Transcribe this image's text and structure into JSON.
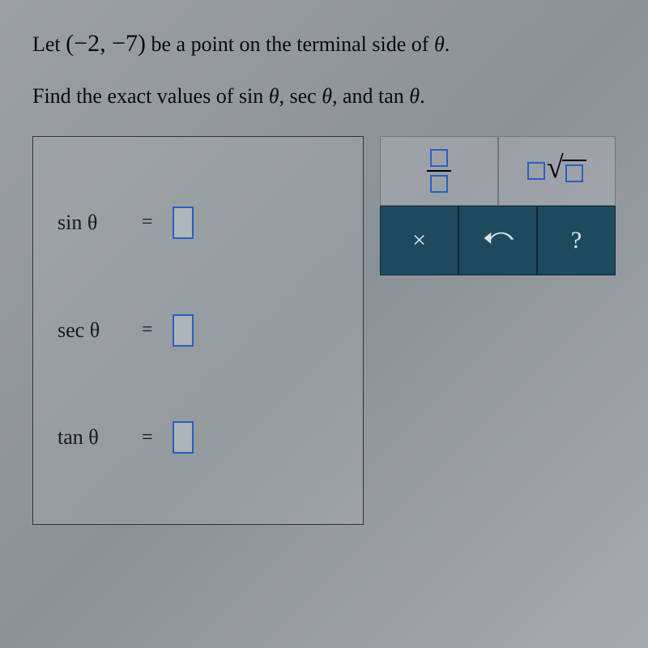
{
  "problem": {
    "line1_pre": "Let ",
    "point": "(−2, −7)",
    "line1_post": " be a point on the terminal side of ",
    "theta1": "θ",
    "period1": ".",
    "line2_pre": "Find the exact values of ",
    "func_sin": "sin",
    "theta2": "θ",
    "comma1": ", ",
    "func_sec": "sec",
    "theta3": "θ",
    "comma2": ", and ",
    "func_tan": "tan",
    "theta4": "θ",
    "period2": "."
  },
  "answers": {
    "row1": {
      "label": "sin θ",
      "eq": "="
    },
    "row2": {
      "label": "sec θ",
      "eq": "="
    },
    "row3": {
      "label": "tan θ",
      "eq": "="
    }
  },
  "toolbar": {
    "fraction": "fraction-template",
    "sqrt": "sqrt-template",
    "close": "×",
    "undo": "undo",
    "help": "?"
  }
}
